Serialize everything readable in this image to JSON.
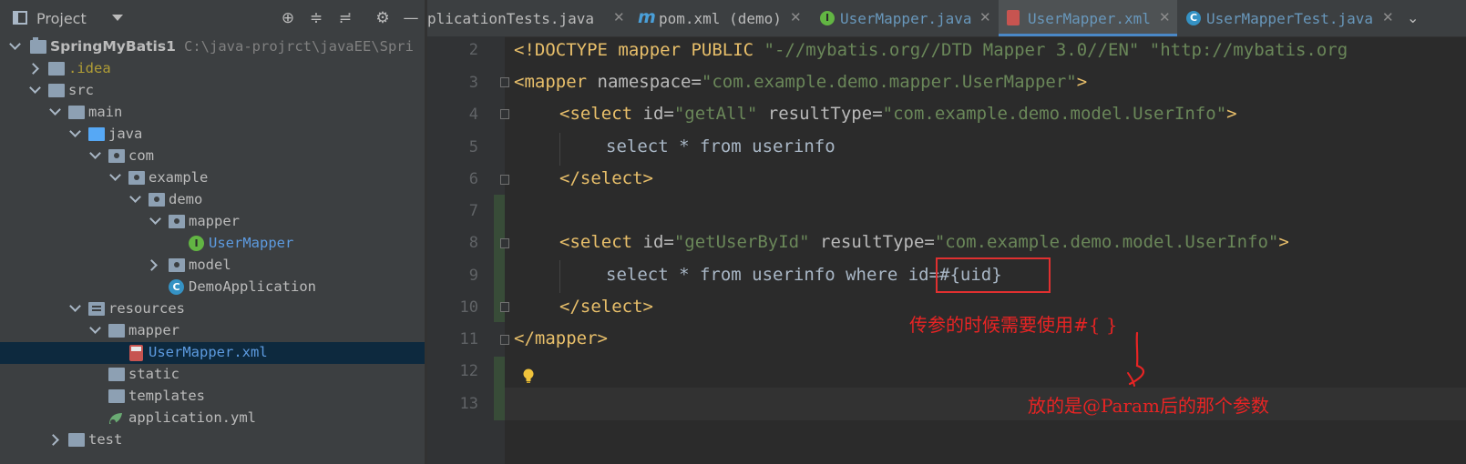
{
  "project": {
    "title": "Project",
    "tools": [
      "target-icon",
      "collapse-all-icon",
      "expand-all-icon",
      "gear-icon",
      "minimize-icon"
    ],
    "tree": [
      {
        "label": "SpringMyBatis1",
        "path": "C:\\java-projrct\\javaEE\\Spri",
        "type": "root"
      },
      {
        "label": ".idea",
        "type": "folder"
      },
      {
        "label": "src",
        "type": "folder"
      },
      {
        "label": "main",
        "type": "folder"
      },
      {
        "label": "java",
        "type": "source-folder"
      },
      {
        "label": "com",
        "type": "package"
      },
      {
        "label": "example",
        "type": "package"
      },
      {
        "label": "demo",
        "type": "package"
      },
      {
        "label": "mapper",
        "type": "package"
      },
      {
        "label": "UserMapper",
        "type": "interface"
      },
      {
        "label": "model",
        "type": "package"
      },
      {
        "label": "DemoApplication",
        "type": "class"
      },
      {
        "label": "resources",
        "type": "resources-folder"
      },
      {
        "label": "mapper",
        "type": "folder"
      },
      {
        "label": "UserMapper.xml",
        "type": "xml",
        "selected": true
      },
      {
        "label": "static",
        "type": "folder"
      },
      {
        "label": "templates",
        "type": "folder"
      },
      {
        "label": "application.yml",
        "type": "yml"
      },
      {
        "label": "test",
        "type": "folder"
      }
    ]
  },
  "tabs": [
    {
      "label": "plicationTests.java",
      "icon": "",
      "active": false
    },
    {
      "label": "pom.xml (demo)",
      "icon": "m",
      "active": false
    },
    {
      "label": "UserMapper.java",
      "icon": "I",
      "active": false
    },
    {
      "label": "UserMapper.xml",
      "icon": "xml",
      "active": true
    },
    {
      "label": "UserMapperTest.java",
      "icon": "C",
      "active": false
    }
  ],
  "editor": {
    "line_numbers": [
      "2",
      "3",
      "4",
      "5",
      "6",
      "7",
      "8",
      "9",
      "10",
      "11",
      "12",
      "13"
    ],
    "lines": {
      "l2": {
        "doctype": "<!DOCTYPE mapper PUBLIC ",
        "s1": "\"-//mybatis.org//DTD Mapper 3.0//EN\"",
        "s2": " \"http://mybatis.org"
      },
      "l3": {
        "tag": "<mapper ",
        "attr": "namespace=",
        "val": "\"com.example.demo.mapper.UserMapper\"",
        "end": ">"
      },
      "l4": {
        "tag": "<select ",
        "attr1": "id=",
        "val1": "\"getAll\"",
        "attr2": " resultType=",
        "val2": "\"com.example.demo.model.UserInfo\"",
        "end": ">"
      },
      "l5": {
        "sql": "select * from userinfo"
      },
      "l6": {
        "tag": "</select>"
      },
      "l8": {
        "tag": "<select ",
        "attr1": "id=",
        "val1": "\"getUserById\"",
        "attr2": " resultType=",
        "val2": "\"com.example.demo.model.UserInfo\"",
        "end": ">"
      },
      "l9": {
        "sql": "select * from userinfo where ",
        "param": "id=#{uid}"
      },
      "l10": {
        "tag": "</select>"
      },
      "l11": {
        "tag": "</mapper>"
      }
    }
  },
  "annotations": {
    "note1": "传参的时候需要使用#{ }",
    "note2": "放的是@Param后的那个参数",
    "color": "#e82424"
  }
}
